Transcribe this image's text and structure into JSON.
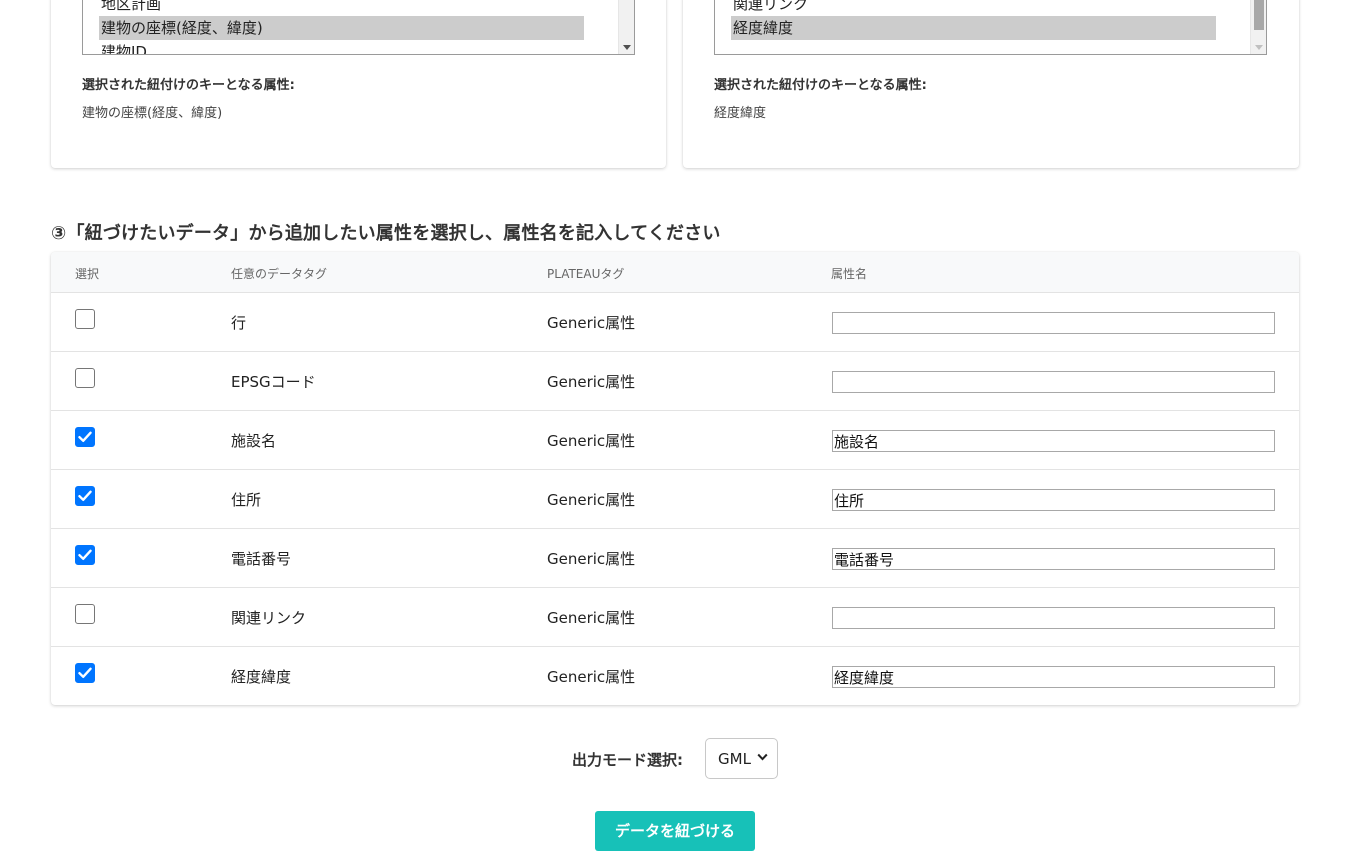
{
  "left_panel": {
    "list_items": [
      "地区計画",
      "建物の座標(経度、緯度)",
      "建物ID"
    ],
    "selected_index": 1,
    "key_label": "選択された紐付けのキーとなる属性:",
    "key_value": "建物の座標(経度、緯度)"
  },
  "right_panel": {
    "list_items": [
      "関連リンク",
      "経度緯度"
    ],
    "selected_index": 1,
    "key_label": "選択された紐付けのキーとなる属性:",
    "key_value": "経度緯度"
  },
  "section": {
    "title": "③「紐づけたいデータ」から追加したい属性を選択し、属性名を記入してください"
  },
  "table": {
    "headers": {
      "select": "選択",
      "tag": "任意のデータタグ",
      "plateau": "PLATEAUタグ",
      "attr": "属性名"
    },
    "rows": [
      {
        "checked": false,
        "tag": "行",
        "plateau": "Generic属性",
        "attr_value": ""
      },
      {
        "checked": false,
        "tag": "EPSGコード",
        "plateau": "Generic属性",
        "attr_value": ""
      },
      {
        "checked": true,
        "tag": "施設名",
        "plateau": "Generic属性",
        "attr_value": "施設名"
      },
      {
        "checked": true,
        "tag": "住所",
        "plateau": "Generic属性",
        "attr_value": "住所"
      },
      {
        "checked": true,
        "tag": "電話番号",
        "plateau": "Generic属性",
        "attr_value": "電話番号"
      },
      {
        "checked": false,
        "tag": "関連リンク",
        "plateau": "Generic属性",
        "attr_value": ""
      },
      {
        "checked": true,
        "tag": "経度緯度",
        "plateau": "Generic属性",
        "attr_value": "経度緯度"
      }
    ]
  },
  "output": {
    "label": "出力モード選択:",
    "selected": "GML"
  },
  "submit": {
    "label": "データを紐づける"
  },
  "colors": {
    "accent": "#17c1b8",
    "checkbox": "#0075ff"
  }
}
